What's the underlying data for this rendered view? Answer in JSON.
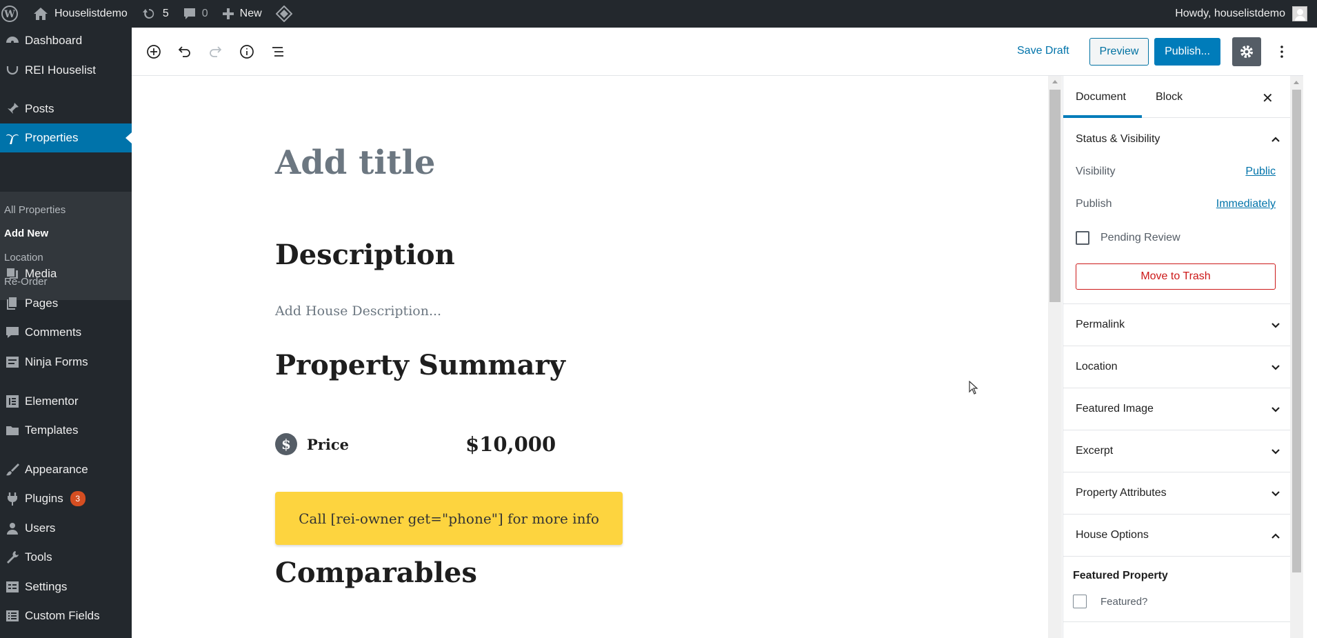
{
  "adminbar": {
    "site_name": "Houselistdemo",
    "updates_count": "5",
    "comments_count": "0",
    "new_label": "New",
    "howdy": "Howdy, houselistdemo"
  },
  "menu": {
    "items": [
      {
        "label": "Dashboard",
        "icon": "dashboard-icon"
      },
      {
        "label": "REI Houselist",
        "icon": "smile-icon"
      },
      {
        "label": "Posts",
        "icon": "pin-icon"
      },
      {
        "label": "Properties",
        "icon": "palm-icon"
      },
      {
        "label": "Media",
        "icon": "media-icon"
      },
      {
        "label": "Pages",
        "icon": "pages-icon"
      },
      {
        "label": "Comments",
        "icon": "comments-icon"
      },
      {
        "label": "Ninja Forms",
        "icon": "forms-icon"
      },
      {
        "label": "Elementor",
        "icon": "elementor-icon"
      },
      {
        "label": "Templates",
        "icon": "folder-icon"
      },
      {
        "label": "Appearance",
        "icon": "brush-icon"
      },
      {
        "label": "Plugins",
        "icon": "plugin-icon",
        "badge": "3"
      },
      {
        "label": "Users",
        "icon": "users-icon"
      },
      {
        "label": "Tools",
        "icon": "wrench-icon"
      },
      {
        "label": "Settings",
        "icon": "settings-icon"
      },
      {
        "label": "Custom Fields",
        "icon": "list-icon"
      }
    ],
    "submenu": [
      "All Properties",
      "Add New",
      "Location",
      "Re-Order"
    ]
  },
  "toolbar": {
    "save_draft": "Save Draft",
    "preview": "Preview",
    "publish": "Publish..."
  },
  "canvas": {
    "title_placeholder": "Add title",
    "description_heading": "Description",
    "description_placeholder": "Add House Description...",
    "summary_heading": "Property Summary",
    "price_label": "Price",
    "price_value": "$10,000",
    "call_text": "Call [rei-owner get=\"phone\"] for more info",
    "comparables_heading": "Comparables"
  },
  "sidebar": {
    "tab_document": "Document",
    "tab_block": "Block",
    "status_heading": "Status & Visibility",
    "visibility_label": "Visibility",
    "visibility_value": "Public",
    "publish_label": "Publish",
    "publish_value": "Immediately",
    "pending_review": "Pending Review",
    "move_to_trash": "Move to Trash",
    "panels": [
      "Permalink",
      "Location",
      "Featured Image",
      "Excerpt",
      "Property Attributes",
      "House Options"
    ],
    "featured_property": "Featured Property",
    "featured_check": "Featured?"
  }
}
